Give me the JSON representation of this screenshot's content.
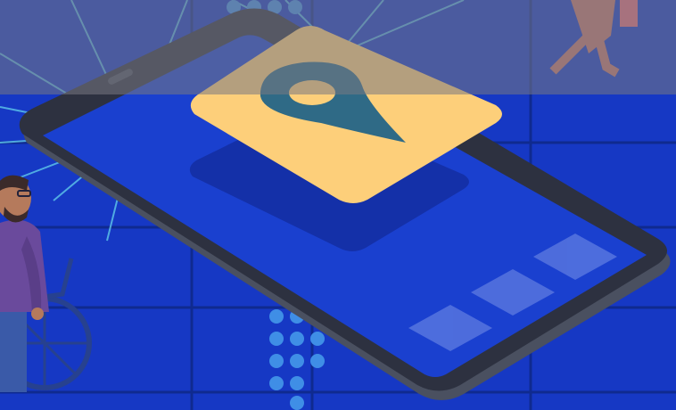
{
  "scene": {
    "description_free": true,
    "colors": {
      "background": "#1638c4",
      "grid_line": "#0f2a8f",
      "ray_line": "#5bc0e8",
      "phone_body": "#2d3140",
      "phone_edge": "#4a5060",
      "phone_screen": "#1a40cf",
      "screen_tile": "#5a78e0",
      "pin_card": "#fdcf7a",
      "pin_card_shadow": "#1430a8",
      "pin_marker": "#2f6a86",
      "dot_pattern": "#3f8ee6",
      "person_shirt": "#6a4a9c",
      "person_skin": "#b57a5c",
      "person_hair": "#3b2a2a",
      "wheelchair": "#27418f",
      "top_overlay": "#787882"
    },
    "icons": [
      "location-pin-icon",
      "wheelchair-icon"
    ]
  }
}
